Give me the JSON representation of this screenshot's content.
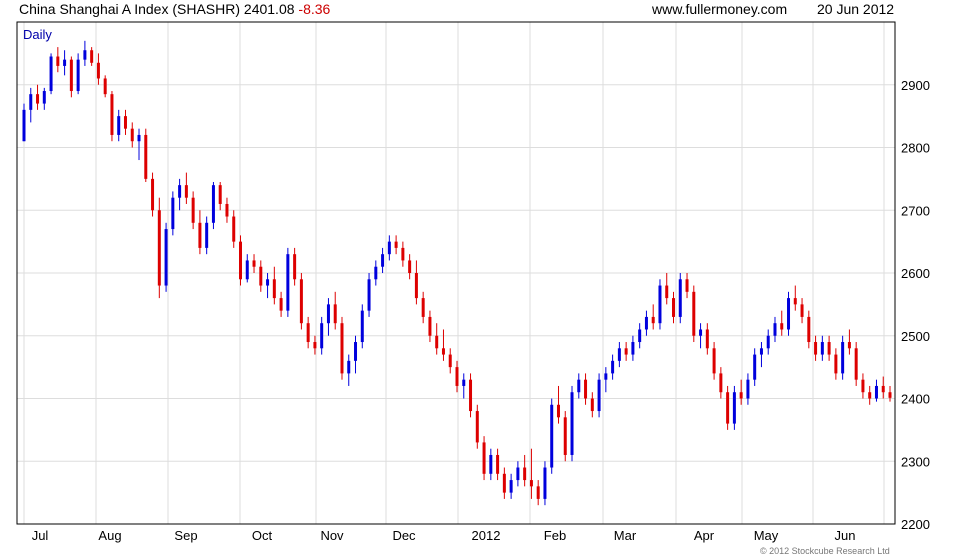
{
  "header": {
    "title": "China Shanghai A Index (SHASHR)",
    "last": "2401.08",
    "change": "-8.36",
    "site": "www.fullermoney.com",
    "date": "20 Jun 2012"
  },
  "copyright": "© 2012 Stockcube Research Ltd",
  "colors": {
    "up": "#0000dd",
    "down": "#dd0000",
    "grid": "#dddddd",
    "frame": "#000000"
  },
  "chart_data": {
    "type": "candlestick",
    "frequency_label": "Daily",
    "ylim": [
      2200,
      3000
    ],
    "y_ticks": [
      2200,
      2300,
      2400,
      2500,
      2600,
      2700,
      2800,
      2900
    ],
    "x_labels": [
      "Jul",
      "Aug",
      "Sep",
      "Oct",
      "Nov",
      "Dec",
      "2012",
      "Feb",
      "Mar",
      "Apr",
      "May",
      "Jun"
    ],
    "grid": true,
    "series": [
      {
        "values": [
          [
            2810,
            2870,
            2810,
            2860
          ],
          [
            2860,
            2895,
            2840,
            2885
          ],
          [
            2885,
            2900,
            2860,
            2870
          ],
          [
            2870,
            2895,
            2860,
            2890
          ],
          [
            2890,
            2950,
            2885,
            2945
          ],
          [
            2945,
            2960,
            2920,
            2930
          ],
          [
            2930,
            2955,
            2915,
            2940
          ],
          [
            2940,
            2945,
            2880,
            2890
          ],
          [
            2890,
            2950,
            2885,
            2940
          ],
          [
            2940,
            2970,
            2930,
            2955
          ],
          [
            2955,
            2960,
            2930,
            2935
          ],
          [
            2935,
            2950,
            2900,
            2910
          ],
          [
            2910,
            2915,
            2880,
            2885
          ],
          [
            2885,
            2890,
            2810,
            2820
          ],
          [
            2820,
            2860,
            2810,
            2850
          ],
          [
            2850,
            2860,
            2820,
            2830
          ],
          [
            2830,
            2840,
            2800,
            2810
          ],
          [
            2810,
            2830,
            2780,
            2820
          ],
          [
            2820,
            2830,
            2745,
            2750
          ],
          [
            2750,
            2760,
            2690,
            2700
          ],
          [
            2700,
            2720,
            2560,
            2580
          ],
          [
            2580,
            2680,
            2570,
            2670
          ],
          [
            2670,
            2730,
            2660,
            2720
          ],
          [
            2720,
            2750,
            2700,
            2740
          ],
          [
            2740,
            2760,
            2710,
            2720
          ],
          [
            2720,
            2730,
            2670,
            2680
          ],
          [
            2680,
            2700,
            2630,
            2640
          ],
          [
            2640,
            2690,
            2630,
            2680
          ],
          [
            2680,
            2745,
            2670,
            2740
          ],
          [
            2740,
            2745,
            2700,
            2710
          ],
          [
            2710,
            2720,
            2680,
            2690
          ],
          [
            2690,
            2700,
            2640,
            2650
          ],
          [
            2650,
            2660,
            2580,
            2590
          ],
          [
            2590,
            2630,
            2585,
            2620
          ],
          [
            2620,
            2630,
            2600,
            2610
          ],
          [
            2610,
            2620,
            2570,
            2580
          ],
          [
            2580,
            2600,
            2560,
            2590
          ],
          [
            2590,
            2610,
            2550,
            2560
          ],
          [
            2560,
            2570,
            2530,
            2540
          ],
          [
            2540,
            2640,
            2530,
            2630
          ],
          [
            2630,
            2640,
            2580,
            2590
          ],
          [
            2590,
            2600,
            2510,
            2520
          ],
          [
            2520,
            2530,
            2480,
            2490
          ],
          [
            2490,
            2500,
            2470,
            2480
          ],
          [
            2480,
            2530,
            2470,
            2520
          ],
          [
            2520,
            2560,
            2500,
            2550
          ],
          [
            2550,
            2570,
            2510,
            2520
          ],
          [
            2520,
            2530,
            2430,
            2440
          ],
          [
            2440,
            2470,
            2420,
            2460
          ],
          [
            2460,
            2500,
            2440,
            2490
          ],
          [
            2490,
            2550,
            2480,
            2540
          ],
          [
            2540,
            2600,
            2530,
            2590
          ],
          [
            2590,
            2620,
            2580,
            2610
          ],
          [
            2610,
            2640,
            2600,
            2630
          ],
          [
            2630,
            2660,
            2620,
            2650
          ],
          [
            2650,
            2660,
            2630,
            2640
          ],
          [
            2640,
            2650,
            2610,
            2620
          ],
          [
            2620,
            2630,
            2590,
            2600
          ],
          [
            2600,
            2620,
            2550,
            2560
          ],
          [
            2560,
            2570,
            2520,
            2530
          ],
          [
            2530,
            2540,
            2490,
            2500
          ],
          [
            2500,
            2520,
            2470,
            2480
          ],
          [
            2480,
            2510,
            2460,
            2470
          ],
          [
            2470,
            2480,
            2440,
            2450
          ],
          [
            2450,
            2460,
            2410,
            2420
          ],
          [
            2420,
            2440,
            2400,
            2430
          ],
          [
            2430,
            2440,
            2370,
            2380
          ],
          [
            2380,
            2390,
            2320,
            2330
          ],
          [
            2330,
            2340,
            2270,
            2280
          ],
          [
            2280,
            2320,
            2270,
            2310
          ],
          [
            2310,
            2320,
            2270,
            2280
          ],
          [
            2280,
            2290,
            2240,
            2250
          ],
          [
            2250,
            2280,
            2240,
            2270
          ],
          [
            2270,
            2300,
            2260,
            2290
          ],
          [
            2290,
            2310,
            2260,
            2270
          ],
          [
            2270,
            2320,
            2240,
            2260
          ],
          [
            2260,
            2270,
            2230,
            2240
          ],
          [
            2240,
            2300,
            2230,
            2290
          ],
          [
            2290,
            2400,
            2280,
            2390
          ],
          [
            2390,
            2420,
            2360,
            2370
          ],
          [
            2370,
            2380,
            2300,
            2310
          ],
          [
            2310,
            2420,
            2300,
            2410
          ],
          [
            2410,
            2440,
            2400,
            2430
          ],
          [
            2430,
            2440,
            2390,
            2400
          ],
          [
            2400,
            2410,
            2370,
            2380
          ],
          [
            2380,
            2440,
            2370,
            2430
          ],
          [
            2430,
            2450,
            2410,
            2440
          ],
          [
            2440,
            2470,
            2430,
            2460
          ],
          [
            2460,
            2490,
            2450,
            2480
          ],
          [
            2480,
            2490,
            2460,
            2470
          ],
          [
            2470,
            2500,
            2460,
            2490
          ],
          [
            2490,
            2520,
            2480,
            2510
          ],
          [
            2510,
            2540,
            2500,
            2530
          ],
          [
            2530,
            2550,
            2510,
            2520
          ],
          [
            2520,
            2590,
            2510,
            2580
          ],
          [
            2580,
            2600,
            2550,
            2560
          ],
          [
            2560,
            2570,
            2520,
            2530
          ],
          [
            2530,
            2600,
            2520,
            2590
          ],
          [
            2590,
            2600,
            2560,
            2570
          ],
          [
            2570,
            2580,
            2490,
            2500
          ],
          [
            2500,
            2520,
            2480,
            2510
          ],
          [
            2510,
            2520,
            2470,
            2480
          ],
          [
            2480,
            2490,
            2430,
            2440
          ],
          [
            2440,
            2450,
            2400,
            2410
          ],
          [
            2410,
            2420,
            2350,
            2360
          ],
          [
            2360,
            2420,
            2350,
            2410
          ],
          [
            2410,
            2430,
            2390,
            2400
          ],
          [
            2400,
            2440,
            2390,
            2430
          ],
          [
            2430,
            2480,
            2420,
            2470
          ],
          [
            2470,
            2490,
            2450,
            2480
          ],
          [
            2480,
            2510,
            2470,
            2500
          ],
          [
            2500,
            2530,
            2490,
            2520
          ],
          [
            2520,
            2540,
            2500,
            2510
          ],
          [
            2510,
            2570,
            2500,
            2560
          ],
          [
            2560,
            2580,
            2540,
            2550
          ],
          [
            2550,
            2560,
            2520,
            2530
          ],
          [
            2530,
            2540,
            2480,
            2490
          ],
          [
            2490,
            2500,
            2460,
            2470
          ],
          [
            2470,
            2500,
            2460,
            2490
          ],
          [
            2490,
            2500,
            2460,
            2470
          ],
          [
            2470,
            2480,
            2430,
            2440
          ],
          [
            2440,
            2500,
            2430,
            2490
          ],
          [
            2490,
            2510,
            2470,
            2480
          ],
          [
            2480,
            2490,
            2420,
            2430
          ],
          [
            2430,
            2440,
            2400,
            2410
          ],
          [
            2410,
            2420,
            2390,
            2400
          ],
          [
            2400,
            2430,
            2395,
            2420
          ],
          [
            2420,
            2435,
            2400,
            2410
          ],
          [
            2410,
            2420,
            2395,
            2401.08
          ]
        ]
      }
    ]
  }
}
